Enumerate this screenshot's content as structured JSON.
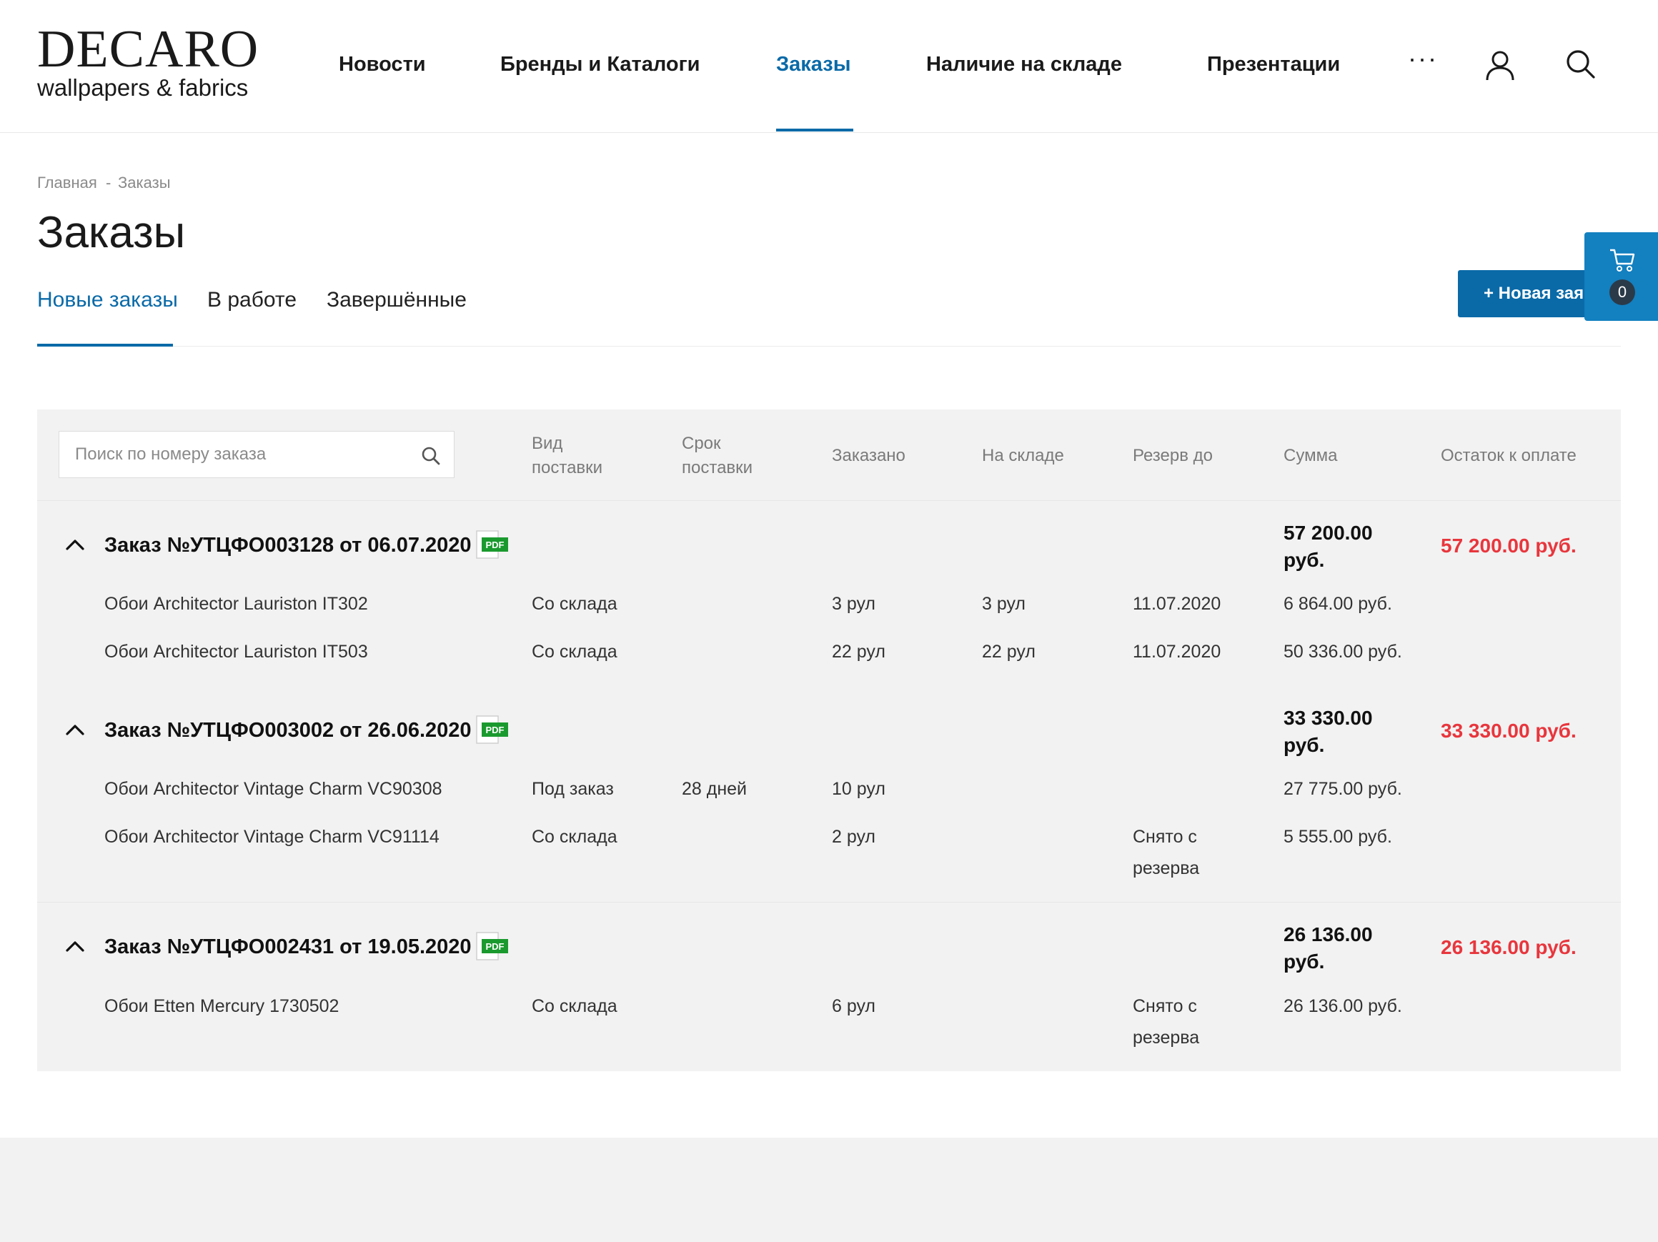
{
  "logo": {
    "title": "DECARO",
    "subtitle": "wallpapers & fabrics"
  },
  "nav": {
    "items": [
      "Новости",
      "Бренды и Каталоги",
      "Заказы",
      "Наличие на складе",
      "Презентации"
    ],
    "more": "···",
    "active_index": 2
  },
  "breadcrumb": {
    "home": "Главная",
    "separator": "-",
    "current": "Заказы"
  },
  "page_title": "Заказы",
  "tabs": [
    "Новые заказы",
    "В работе",
    "Завершённые"
  ],
  "new_button": "+ Новая заявка",
  "cart": {
    "count": "0"
  },
  "search": {
    "placeholder": "Поиск по номеру заказа"
  },
  "columns": {
    "delivery_type": [
      "Вид",
      "поставки"
    ],
    "delivery_term": [
      "Срок",
      "поставки"
    ],
    "ordered": "Заказано",
    "in_stock": "На складе",
    "reserve_until": "Резерв до",
    "sum": "Сумма",
    "due": "Остаток к оплате"
  },
  "orders": [
    {
      "title": "Заказ №УТЦФО003128 от 06.07.2020",
      "sum": "57 200.00 руб.",
      "due": "57 200.00 руб.",
      "items": [
        {
          "name": "Обои Architector Lauriston IT302",
          "type": "Со склада",
          "term": "",
          "ordered": "3 рул",
          "stock": "3 рул",
          "reserve": "11.07.2020",
          "sum": "6 864.00 руб."
        },
        {
          "name": "Обои Architector Lauriston IT503",
          "type": "Со склада",
          "term": "",
          "ordered": "22 рул",
          "stock": "22 рул",
          "reserve": "11.07.2020",
          "sum": "50 336.00 руб."
        }
      ]
    },
    {
      "title": "Заказ №УТЦФО003002 от 26.06.2020",
      "sum": "33 330.00 руб.",
      "due": "33 330.00 руб.",
      "items": [
        {
          "name": "Обои Architector Vintage Charm VC90308",
          "type": "Под заказ",
          "term": "28 дней",
          "ordered": "10 рул",
          "stock": "",
          "reserve": "",
          "sum": "27 775.00 руб."
        },
        {
          "name": "Обои Architector Vintage Charm VC91114",
          "type": "Со склада",
          "term": "",
          "ordered": "2 рул",
          "stock": "",
          "reserve": "Снято с резерва",
          "sum": "5 555.00 руб."
        }
      ]
    },
    {
      "title": "Заказ №УТЦФО002431 от 19.05.2020",
      "sum": "26 136.00 руб.",
      "due": "26 136.00 руб.",
      "items": [
        {
          "name": "Обои Etten Mercury 1730502",
          "type": "Со склада",
          "term": "",
          "ordered": "6 рул",
          "stock": "",
          "reserve": "Снято с резерва",
          "sum": "26 136.00 руб."
        }
      ]
    }
  ],
  "pdf_label": "PDF",
  "colors": {
    "accent": "#0a6aa8",
    "due": "#e8363d",
    "panel": "#f2f2f2",
    "pdf": "#1a9a2e"
  },
  "icons": [
    "user-icon",
    "search-icon",
    "cart-icon",
    "caret-up-icon",
    "pdf-icon"
  ]
}
